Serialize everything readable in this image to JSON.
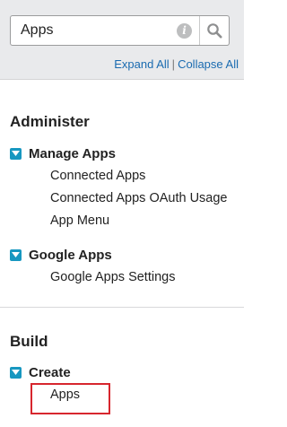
{
  "search": {
    "value": "Apps",
    "info_glyph": "i",
    "icon": "search-icon"
  },
  "expand_controls": {
    "expand_all": "Expand All",
    "separator": "|",
    "collapse_all": "Collapse All"
  },
  "sections": [
    {
      "title": "Administer",
      "groups": [
        {
          "label": "Manage Apps",
          "expanded": true,
          "items": [
            "Connected Apps",
            "Connected Apps OAuth Usage",
            "App Menu"
          ]
        },
        {
          "label": "Google Apps",
          "expanded": true,
          "items": [
            "Google Apps Settings"
          ]
        }
      ]
    },
    {
      "title": "Build",
      "groups": [
        {
          "label": "Create",
          "expanded": true,
          "items": [
            "Apps"
          ]
        }
      ]
    }
  ],
  "colors": {
    "link": "#1a6bb0",
    "toggle": "#1797c0",
    "highlight": "#d7262e",
    "panel_bg": "#e9eaec"
  }
}
